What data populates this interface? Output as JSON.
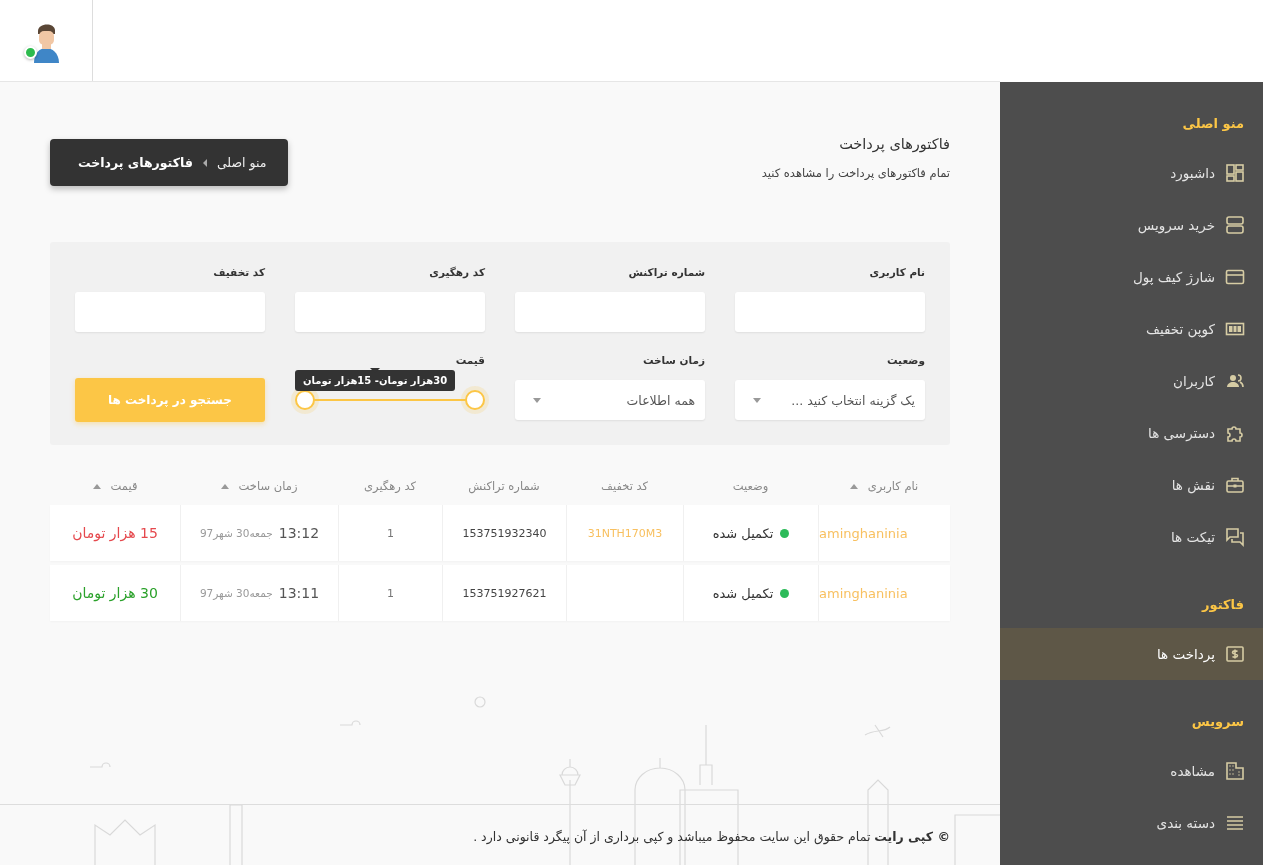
{
  "header": {
    "avatar": {
      "online": true
    }
  },
  "sidebar": {
    "sections": [
      {
        "title": "منو اصلی",
        "items": [
          {
            "label": "داشبورد",
            "selected": false
          },
          {
            "label": "خرید سرویس",
            "selected": false
          },
          {
            "label": "شارژ کیف پول",
            "selected": false
          },
          {
            "label": "کوپن تخفیف",
            "selected": false
          },
          {
            "label": "کاربران",
            "selected": false
          },
          {
            "label": "دسترسی ها",
            "selected": false
          },
          {
            "label": "نقش ها",
            "selected": false
          },
          {
            "label": "تیکت ها",
            "selected": false
          }
        ]
      },
      {
        "title": "فاکتور",
        "items": [
          {
            "label": "پرداخت ها",
            "selected": true
          }
        ]
      },
      {
        "title": "سرویس",
        "items": [
          {
            "label": "مشاهده",
            "selected": false
          },
          {
            "label": "دسته بندی",
            "selected": false
          }
        ]
      }
    ]
  },
  "page": {
    "title": "فاکتورهای پرداخت",
    "subtitle": "تمام فاکتورهای پرداخت را مشاهده کنید"
  },
  "breadcrumb": [
    {
      "label": "منو اصلی",
      "current": false
    },
    {
      "label": "فاکتورهای پرداخت",
      "current": true
    }
  ],
  "filters": {
    "fields": [
      {
        "kind": "text",
        "label": "نام کاربری"
      },
      {
        "kind": "text",
        "label": "شماره تراکنش"
      },
      {
        "kind": "text",
        "label": "کد رهگیری"
      },
      {
        "kind": "text",
        "label": "کد تخفیف"
      },
      {
        "kind": "select",
        "label": "وضعیت",
        "placeholder": "یک گزینه انتخاب کنید ..."
      },
      {
        "kind": "select",
        "label": "زمان ساخت",
        "value": "همه اطلاعات"
      },
      {
        "kind": "range",
        "label": "قیمت",
        "tooltip": "30هزار تومان- 15هزار تومان",
        "level": 1
      }
    ],
    "search_button": "جستجو در پرداخت ها"
  },
  "table": {
    "columns": [
      {
        "label": "نام کاربری",
        "sortable": true
      },
      {
        "label": "وضعیت",
        "sortable": false
      },
      {
        "label": "کد تخفیف",
        "sortable": false
      },
      {
        "label": "شماره تراکنش",
        "sortable": false
      },
      {
        "label": "کد رهگیری",
        "sortable": false
      },
      {
        "label": "زمان ساخت",
        "sortable": true
      },
      {
        "label": "قیمت",
        "sortable": true
      }
    ],
    "rows": [
      {
        "username": "aminghaninia",
        "status": {
          "label": "تکمیل شده",
          "color": "#2dbb5a"
        },
        "coupon": "31NTH170M3",
        "transaction": "153751932340",
        "tracking": "1",
        "time": "13:12",
        "date": "جمعه30 شهر97",
        "price": {
          "text": "15 هزار تومان",
          "color": "#e5484d"
        }
      },
      {
        "username": "aminghaninia",
        "status": {
          "label": "تکمیل شده",
          "color": "#2dbb5a"
        },
        "transaction": "153751927621",
        "tracking": "1",
        "time": "13:11",
        "date": "جمعه30 شهر97",
        "price": {
          "text": "30 هزار تومان",
          "color": "#2aa12a"
        }
      }
    ]
  },
  "footer": {
    "text": "**© کپی رایت** تمام حقوق این سایت محفوظ میباشد و کپی برداری از آن پیگرد قانونی دارد ."
  }
}
